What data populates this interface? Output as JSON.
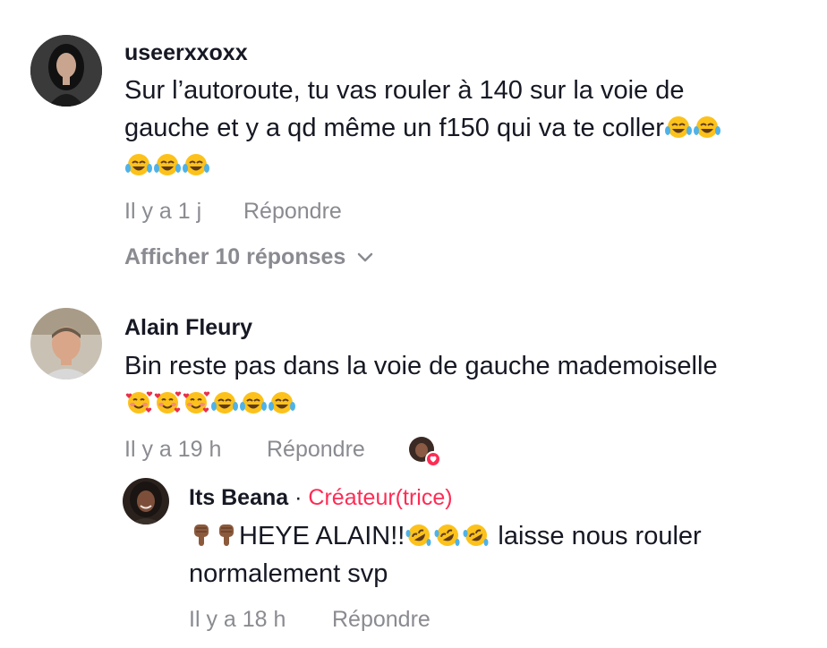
{
  "comments": [
    {
      "username": "useerxxoxx",
      "text_line1": "Sur l’autoroute, tu vas rouler à 140 sur la voie de",
      "text_line2": "gauche et y a qd même un f150 qui va te coller",
      "time": "Il y a 1 j",
      "reply_label": "Répondre",
      "view_replies_label": "Afficher 10 réponses",
      "emojis_line2": [
        "face-with-tears-of-joy-emoji",
        "face-with-tears-of-joy-emoji"
      ],
      "emojis_line3": [
        "face-with-tears-of-joy-emoji",
        "face-with-tears-of-joy-emoji",
        "face-with-tears-of-joy-emoji"
      ]
    },
    {
      "username": "Alain Fleury",
      "text_line1": "Bin reste pas dans la voie de gauche mademoiselle",
      "time": "Il y a 19 h",
      "reply_label": "Répondre",
      "emojis_line2": [
        "smiling-face-with-hearts-emoji",
        "smiling-face-with-hearts-emoji",
        "smiling-face-with-hearts-emoji",
        "face-with-tears-of-joy-emoji",
        "face-with-tears-of-joy-emoji",
        "face-with-tears-of-joy-emoji"
      ],
      "liked_by_creator_icon": "creator-heart-avatar-icon"
    }
  ],
  "reply": {
    "username": "Its Beana",
    "separator": "·",
    "creator_label": "Créateur(trice)",
    "text_part1": "HEYE ALAIN!!",
    "text_part2": " laisse nous rouler",
    "text_line2": "normalement svp",
    "time": "Il y a 18 h",
    "reply_label": "Répondre",
    "emojis_prefix": [
      "pointing-down-emoji",
      "pointing-down-emoji"
    ],
    "emojis_mid": [
      "rolling-on-floor-laughing-emoji",
      "rolling-on-floor-laughing-emoji",
      "rolling-on-floor-laughing-emoji"
    ]
  },
  "colors": {
    "text": "#161823",
    "secondary": "#8a8b91",
    "creator": "#fe2c55"
  },
  "icons": [
    "chevron-down-icon"
  ]
}
